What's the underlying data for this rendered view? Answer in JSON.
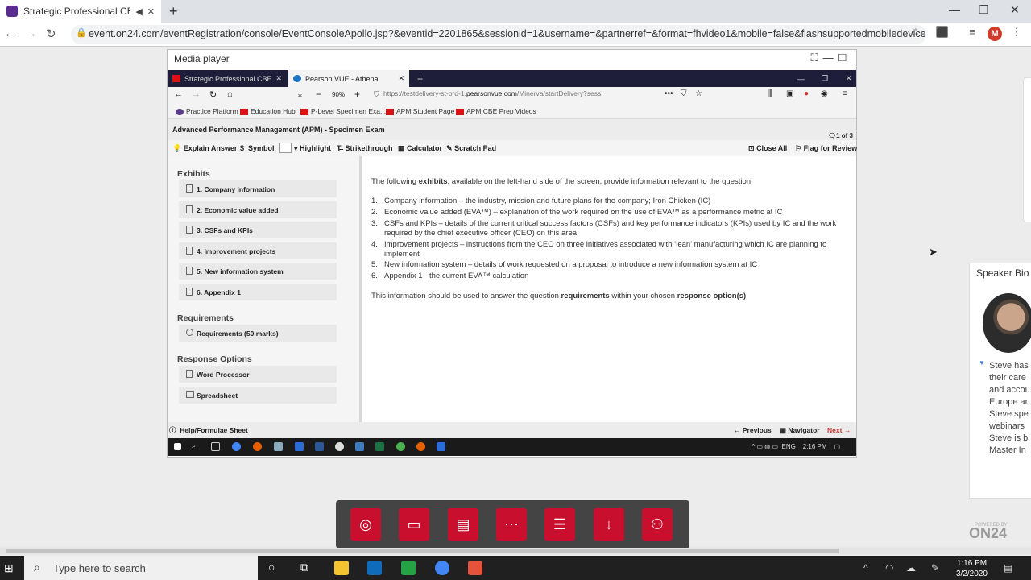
{
  "browser": {
    "tab_title": "Strategic Professional CBE -",
    "url": "event.on24.com/eventRegistration/console/EventConsoleApollo.jsp?&eventid=2201865&sessionid=1&username=&partnerref=&format=fhvideo1&mobile=false&flashsupportedmobiledevice=...",
    "avatar_letter": "M"
  },
  "media_player": {
    "title": "Media player"
  },
  "firefox": {
    "tab1": "Strategic Professional CBE spec",
    "tab2": "Pearson VUE - Athena",
    "zoom": "90%",
    "url_prefix": "https://testdelivery-st-prd-1.",
    "url_domain": "pearsonvue.com",
    "url_path": "/Minerva/startDelivery?sessi",
    "bookmarks": [
      "Practice Platform",
      "Education Hub",
      "P-Level Specimen Exa...",
      "APM Student Page",
      "APM CBE Prep Videos"
    ]
  },
  "exam": {
    "title": "Advanced Performance Management (APM) - Specimen Exam",
    "page_count": "1 of 3",
    "toolbar": {
      "explain": "Explain Answer",
      "symbol": "Symbol",
      "highlight": "Highlight",
      "strikethrough": "Strikethrough",
      "calculator": "Calculator",
      "scratch": "Scratch Pad",
      "close_all": "Close All",
      "flag": "Flag for Review"
    },
    "exhibits_header": "Exhibits",
    "exhibits": [
      "1. Company information",
      "2. Economic value added",
      "3. CSFs and KPIs",
      "4. Improvement projects",
      "5. New information system",
      "6. Appendix 1"
    ],
    "requirements_header": "Requirements",
    "requirements": [
      "Requirements (50 marks)"
    ],
    "response_header": "Response Options",
    "responses": [
      "Word Processor",
      "Spreadsheet"
    ],
    "intro_a": "The following ",
    "intro_b": "exhibits",
    "intro_c": ", available on the left-hand side of the screen, provide information relevant to the question:",
    "list": [
      "Company information – the industry, mission and future plans for the company; Iron Chicken (IC)",
      "Economic value added (EVA™) – explanation of the work required on the use of EVA™ as a performance metric at IC",
      "CSFs and KPIs – details of the current critical success factors (CSFs) and key performance indicators (KPIs) used by IC and the work required by the chief executive officer (CEO) on this area",
      "Improvement projects – instructions from the CEO on three initiatives associated with ‘lean’ manufacturing which IC are planning to implement",
      "New information system – details of work requested on a proposal to introduce a new information system at IC",
      "Appendix 1 - the current EVA™ calculation"
    ],
    "outro_a": "This information should be used to answer the question ",
    "outro_b": "requirements",
    "outro_c": " within your chosen ",
    "outro_d": "response option(s)",
    "outro_e": ".",
    "help": "Help/Formulae Sheet",
    "previous": "Previous",
    "navigator": "Navigator",
    "next": "Next"
  },
  "inner_taskbar": {
    "lang": "ENG",
    "time": "2:16 PM"
  },
  "speaker_bio": {
    "header": "Speaker Bio",
    "lines": [
      "Steve has",
      "their care",
      "and accou",
      "Europe an",
      "Steve spe",
      "webinars",
      "Steve is b",
      "Master In"
    ]
  },
  "on24": {
    "powered": "POWERED BY",
    "logo": "ON24"
  },
  "windows": {
    "search_placeholder": "Type here to search",
    "time": "1:16 PM",
    "date": "3/2/2020"
  },
  "colors": {
    "dock_red": "#c8102e",
    "on24_brand": "#5b2c8f"
  }
}
